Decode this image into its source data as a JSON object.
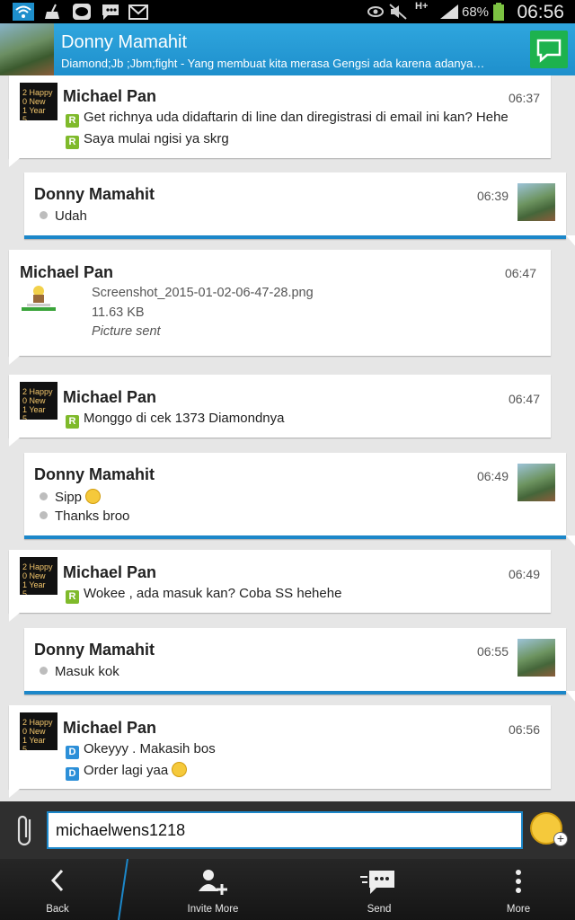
{
  "status_bar": {
    "battery_percent": "68%",
    "time": "06:56",
    "network_label": "H+",
    "icons": [
      "wifi-icon",
      "broom-icon",
      "line-app-icon",
      "bbm-icon",
      "mail-icon",
      "eye-icon",
      "mute-icon",
      "signal-icon",
      "battery-icon"
    ]
  },
  "header": {
    "name": "Donny Mamahit",
    "status": "Diamond;Jb  ;Jbm;fight - Yang membuat kita merasa Gengsi ada karena adanya…",
    "accent_color": "#1e8fcc"
  },
  "messages": [
    {
      "sender": "Michael Pan",
      "time": "06:37",
      "lines": [
        {
          "tag": "R",
          "text": "Get richnya uda didaftarin di line dan diregistrasi di email ini kan? Hehe"
        },
        {
          "tag": "R",
          "text": "Saya mulai ngisi ya skrg"
        }
      ]
    },
    {
      "sender": "Donny Mamahit",
      "time": "06:39",
      "lines": [
        {
          "text": "Udah"
        }
      ]
    },
    {
      "sender": "Michael Pan",
      "time": "06:47",
      "file": {
        "name": "Screenshot_2015-01-02-06-47-28.png",
        "size": "11.63 KB",
        "status": "Picture sent"
      }
    },
    {
      "sender": "Michael Pan",
      "time": "06:47",
      "lines": [
        {
          "tag": "R",
          "text": "Monggo di cek 1373 Diamondnya"
        }
      ]
    },
    {
      "sender": "Donny Mamahit",
      "time": "06:49",
      "lines": [
        {
          "text": "Sipp"
        },
        {
          "text": "Thanks broo"
        }
      ]
    },
    {
      "sender": "Michael Pan",
      "time": "06:49",
      "lines": [
        {
          "tag": "R",
          "text": "Wokee , ada masuk kan? Coba SS hehehe"
        }
      ]
    },
    {
      "sender": "Donny Mamahit",
      "time": "06:55",
      "lines": [
        {
          "text": "Masuk kok"
        }
      ]
    },
    {
      "sender": "Michael Pan",
      "time": "06:56",
      "lines": [
        {
          "tag": "D",
          "text": "Okeyyy . Makasih bos"
        },
        {
          "tag": "D",
          "text": "Order lagi yaa"
        }
      ]
    }
  ],
  "composer": {
    "value": "michaelwens1218"
  },
  "bottom_bar": {
    "back": "Back",
    "invite_more": "Invite More",
    "send": "Send",
    "more": "More"
  }
}
